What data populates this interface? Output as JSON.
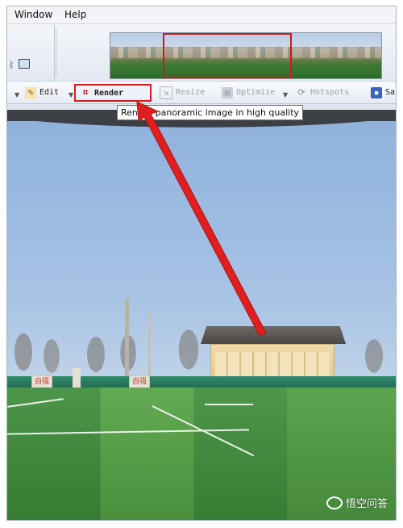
{
  "menubar": {
    "items": [
      "Window",
      "Help"
    ]
  },
  "toolbar": {
    "edit": "Edit",
    "render": "Render",
    "resize": "Resize",
    "optimize": "Optimize",
    "hotspots": "Hotspots",
    "save": "Sa"
  },
  "tooltip": {
    "text": "Render panoramic image in high quality"
  },
  "panorama": {
    "sign_left": "自强",
    "sign_right": "自强"
  },
  "watermark": {
    "text": "悟空问答"
  },
  "colors": {
    "highlight": "#d61c1c",
    "arrow": "#e02020"
  }
}
